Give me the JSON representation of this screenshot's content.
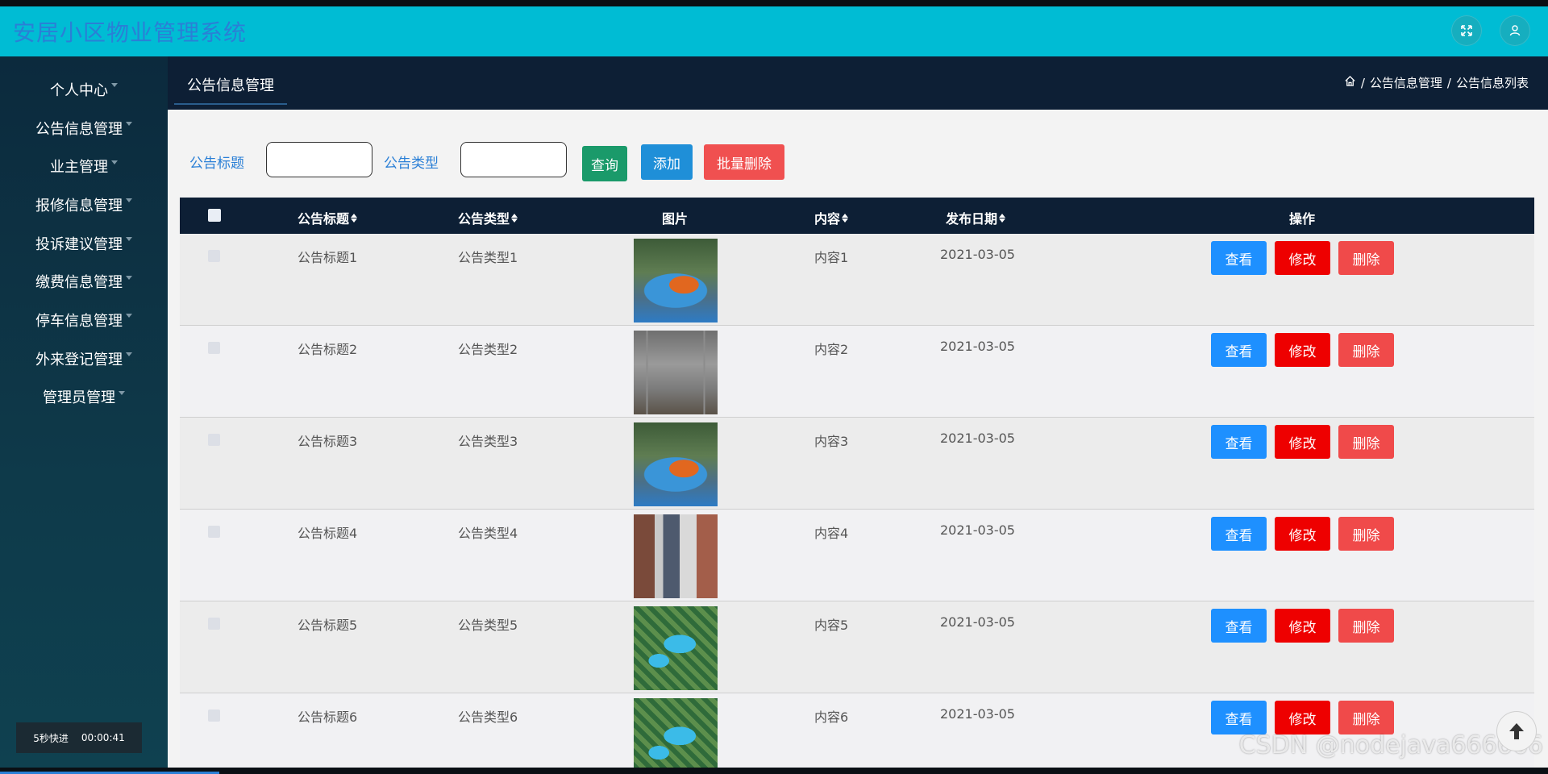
{
  "app": {
    "title": "安居小区物业管理系统"
  },
  "header_icons": [
    "fullscreen-icon",
    "user-icon"
  ],
  "sidebar": {
    "items": [
      {
        "label": "个人中心"
      },
      {
        "label": "公告信息管理"
      },
      {
        "label": "业主管理"
      },
      {
        "label": "报修信息管理"
      },
      {
        "label": "投诉建议管理"
      },
      {
        "label": "缴费信息管理"
      },
      {
        "label": "停车信息管理"
      },
      {
        "label": "外来登记管理"
      },
      {
        "label": "管理员管理"
      }
    ]
  },
  "player": {
    "speed_label": "5秒快进",
    "time": "00:00:41"
  },
  "content": {
    "tab_label": "公告信息管理",
    "breadcrumb": [
      "公告信息管理",
      "公告信息列表"
    ]
  },
  "search": {
    "title_label": "公告标题",
    "type_label": "公告类型",
    "title_value": "",
    "type_value": "",
    "query_button": "查询",
    "add_button": "添加",
    "batch_delete_button": "批量删除"
  },
  "table": {
    "headers": [
      "公告标题",
      "公告类型",
      "图片",
      "内容",
      "发布日期",
      "操作"
    ],
    "view_label": "查看",
    "edit_label": "修改",
    "delete_label": "删除",
    "rows": [
      {
        "title": "公告标题1",
        "type": "公告类型1",
        "content": "内容1",
        "date": "2021-03-05"
      },
      {
        "title": "公告标题2",
        "type": "公告类型2",
        "content": "内容2",
        "date": "2021-03-05"
      },
      {
        "title": "公告标题3",
        "type": "公告类型3",
        "content": "内容3",
        "date": "2021-03-05"
      },
      {
        "title": "公告标题4",
        "type": "公告类型4",
        "content": "内容4",
        "date": "2021-03-05"
      },
      {
        "title": "公告标题5",
        "type": "公告类型5",
        "content": "内容5",
        "date": "2021-03-05"
      },
      {
        "title": "公告标题6",
        "type": "公告类型6",
        "content": "内容6",
        "date": "2021-03-05"
      }
    ]
  },
  "colors": {
    "header": "#00bcd4",
    "sidebar": "#0e3a4a",
    "navbar": "#0d1f35",
    "view_button": "#1e90ff",
    "edit_button": "#ee0000",
    "delete_button": "#f04a4a",
    "query_button": "#1a9a6a",
    "add_button": "#1f8fd8",
    "batch_delete_button": "#f05050"
  },
  "watermark": "CSDN @nodejava666666"
}
